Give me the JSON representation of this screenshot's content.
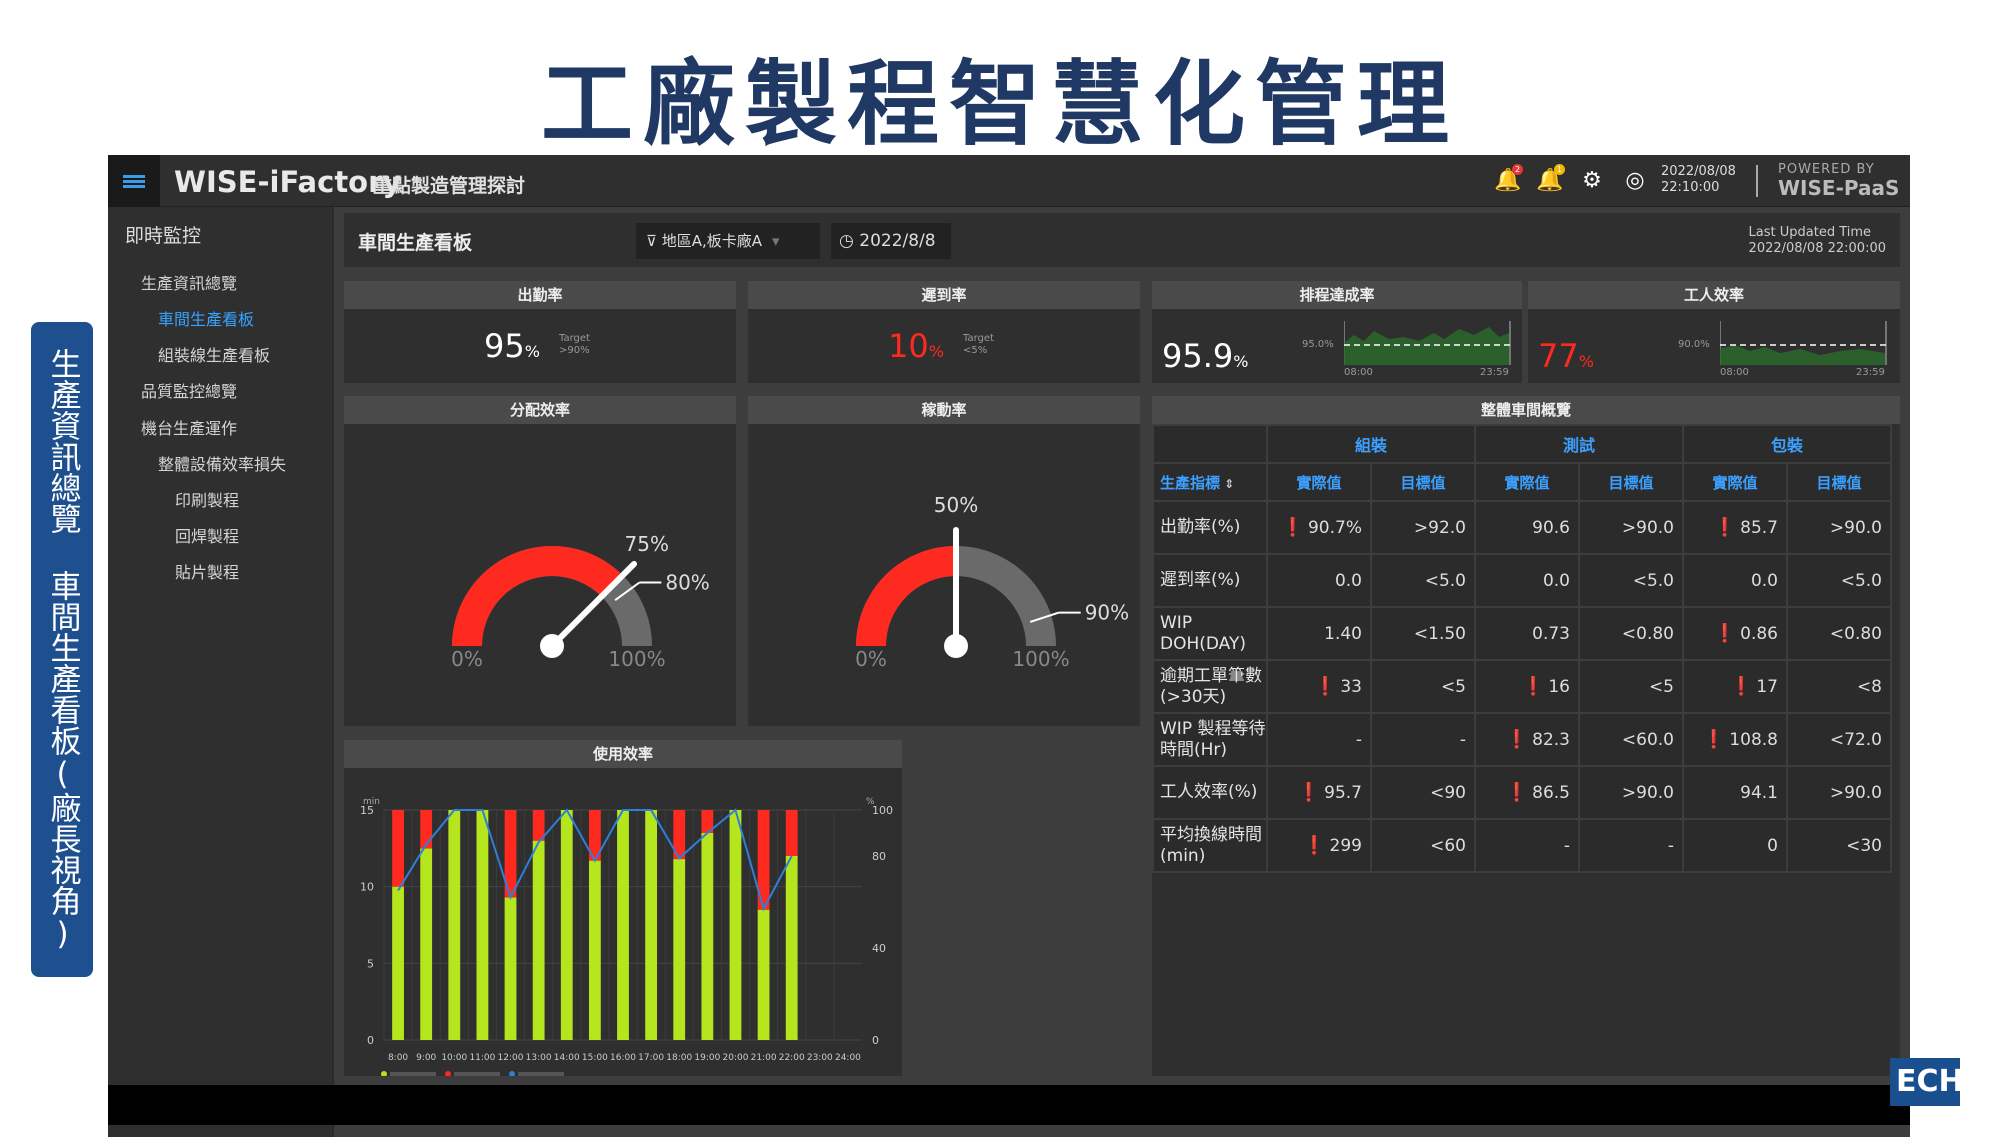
{
  "slide": {
    "title": "工廠製程智慧化管理",
    "side_label": "生產資訊總覽 車間生產看板(廠長視角)",
    "logo_fragment": "ECH"
  },
  "topbar": {
    "brand": "WISE-iFactory",
    "subtitle": "重點製造管理探討",
    "badge_alert": "2",
    "badge_notice": "1",
    "date": "2022/08/08",
    "time": "22:10:00",
    "powered_by": "POWERED BY",
    "platform": "WISE-PaaS"
  },
  "sidebar": {
    "section": "即時監控",
    "items": [
      "生產資訊總覽",
      "車間生產看板",
      "組裝線生產看板",
      "品質監控總覽",
      "機台生產運作",
      "整體設備效率損失",
      "印刷製程",
      "回焊製程",
      "貼片製程"
    ]
  },
  "filter": {
    "board_title": "車間生產看板",
    "region": "地區A,板卡廠A",
    "date": "2022/8/8",
    "updated_label": "Last Updated Time",
    "updated_value": "2022/08/08 22:00:00"
  },
  "kpi": {
    "attendance": {
      "title": "出勤率",
      "value": "95",
      "unit": "%",
      "target_label": "Target",
      "target": ">90%"
    },
    "late": {
      "title": "遲到率",
      "value": "10",
      "unit": "%",
      "target_label": "Target",
      "target": "<5%"
    },
    "schedule": {
      "title": "排程達成率",
      "value": "95.9",
      "unit": "%",
      "ref": "95.0%",
      "t_start": "08:00",
      "t_end": "23:59"
    },
    "worker": {
      "title": "工人效率",
      "value": "77",
      "unit": "%",
      "ref": "90.0%",
      "t_start": "08:00",
      "t_end": "23:59"
    }
  },
  "gauges": {
    "alloc": {
      "title": "分配效率",
      "value": 75,
      "value_label": "75%",
      "target": 80,
      "target_label": "80%",
      "min_label": "0%",
      "max_label": "100%"
    },
    "util": {
      "title": "稼動率",
      "value": 50,
      "value_label": "50%",
      "target": 90,
      "target_label": "90%",
      "min_label": "0%",
      "max_label": "100%"
    }
  },
  "colors": {
    "red": "#ff2a1f",
    "gray": "#6a6a6a",
    "green": "#b5e61d",
    "blue": "#2e7fd9",
    "accent": "#37a3ff"
  },
  "overview": {
    "title": "整體車間概覽",
    "groups": [
      "組裝",
      "測試",
      "包裝"
    ],
    "metric_header": "生產指標",
    "col_actual": "實際值",
    "col_target": "目標值",
    "rows": [
      {
        "label": "出勤率(%)",
        "cells": [
          [
            "90.7%",
            true
          ],
          [
            ">92.0",
            false
          ],
          [
            "90.6",
            false
          ],
          [
            ">90.0",
            false
          ],
          [
            "85.7",
            true
          ],
          [
            ">90.0",
            false
          ]
        ]
      },
      {
        "label": "遲到率(%)",
        "cells": [
          [
            "0.0",
            false
          ],
          [
            "<5.0",
            false
          ],
          [
            "0.0",
            false
          ],
          [
            "<5.0",
            false
          ],
          [
            "0.0",
            false
          ],
          [
            "<5.0",
            false
          ]
        ]
      },
      {
        "label": "WIP DOH(DAY)",
        "cells": [
          [
            "1.40",
            false
          ],
          [
            "<1.50",
            false
          ],
          [
            "0.73",
            false
          ],
          [
            "<0.80",
            false
          ],
          [
            "0.86",
            true
          ],
          [
            "<0.80",
            false
          ]
        ]
      },
      {
        "label": "逾期工單筆數(>30天)",
        "cells": [
          [
            "33",
            true
          ],
          [
            "<5",
            false
          ],
          [
            "16",
            true
          ],
          [
            "<5",
            false
          ],
          [
            "17",
            true
          ],
          [
            "<8",
            false
          ]
        ]
      },
      {
        "label": "WIP 製程等待時間(Hr)",
        "cells": [
          [
            "-",
            false
          ],
          [
            "-",
            false
          ],
          [
            "82.3",
            true
          ],
          [
            "<60.0",
            false
          ],
          [
            "108.8",
            true
          ],
          [
            "<72.0",
            false
          ]
        ]
      },
      {
        "label": "工人效率(%)",
        "cells": [
          [
            "95.7",
            true
          ],
          [
            "<90",
            false
          ],
          [
            "86.5",
            true
          ],
          [
            ">90.0",
            false
          ],
          [
            "94.1",
            false
          ],
          [
            ">90.0",
            false
          ]
        ]
      },
      {
        "label": "平均換線時間(min)",
        "cells": [
          [
            "299",
            true
          ],
          [
            "<60",
            false
          ],
          [
            "-",
            false
          ],
          [
            "-",
            false
          ],
          [
            "0",
            false
          ],
          [
            "<30",
            false
          ]
        ]
      }
    ]
  },
  "chart_data": {
    "type": "bar",
    "title": "使用效率",
    "y_left_unit": "min",
    "y_right_unit": "%",
    "ylim": [
      0,
      15
    ],
    "y2lim": [
      0,
      100
    ],
    "yticks": [
      0,
      5,
      10,
      15
    ],
    "y2ticks": [
      0,
      40,
      80,
      100
    ],
    "categories": [
      "8:00",
      "9:00",
      "10:00",
      "11:00",
      "12:00",
      "13:00",
      "14:00",
      "15:00",
      "16:00",
      "17:00",
      "18:00",
      "19:00",
      "20:00",
      "21:00",
      "22:00",
      "23:00",
      "24:00"
    ],
    "series": [
      {
        "name": "",
        "kind": "bar",
        "color": "#b5e61d",
        "values": [
          10,
          12.5,
          15,
          15,
          9.3,
          13,
          15,
          11.7,
          15,
          15,
          11.8,
          13.5,
          15,
          8.5,
          12,
          null,
          null
        ]
      },
      {
        "name": "",
        "kind": "bar",
        "color": "#ff2a1f",
        "values": [
          5,
          2.5,
          0,
          0,
          5.7,
          2,
          0,
          3.3,
          0,
          0,
          3.2,
          1.5,
          0,
          6.5,
          3,
          null,
          null
        ]
      },
      {
        "name": "",
        "kind": "line",
        "color": "#2e7fd9",
        "values": [
          65,
          85,
          100,
          100,
          62,
          86,
          100,
          78,
          100,
          100,
          79,
          90,
          100,
          57,
          80,
          null,
          null
        ]
      }
    ],
    "grid": true,
    "legend": "bottom-left"
  }
}
